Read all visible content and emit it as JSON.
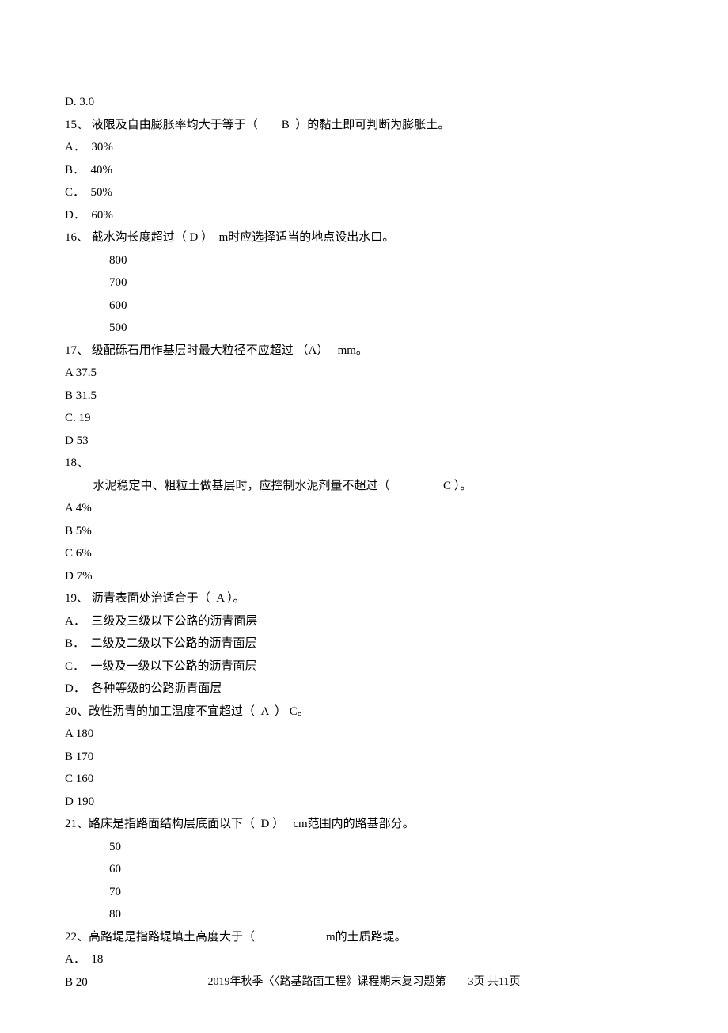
{
  "q14": {
    "optD": "D. 3.0"
  },
  "q15": {
    "stem_a": "15、 液限及自由膨胀率均大于等于（",
    "ans": "B",
    "stem_b": "）的黏土即可判断为膨胀土。",
    "A": "A．  30%",
    "B": "B．  40%",
    "C": "C．  50%",
    "D": "D．  60%"
  },
  "q16": {
    "stem_a": "16、 截水沟长度超过（ D ）  m时应选择适当的地点设出水口。",
    "A": "800",
    "B": "700",
    "C": "600",
    "D": "500"
  },
  "q17": {
    "stem": "17、 级配砾石用作基层时最大粒径不应超过 （A）   mm。",
    "A": "A 37.5",
    "B": "B 31.5",
    "C": "C. 19",
    "D": "D 53"
  },
  "q18": {
    "num": "18、",
    "stem_a": "水泥稳定中、粗粒土做基层时，应控制水泥剂量不超过（",
    "ans": "C",
    "stem_b": "）。",
    "A": "A 4%",
    "B": "B 5%",
    "C": "C 6%",
    "D": "D 7%"
  },
  "q19": {
    "stem": "19、 沥青表面处治适合于（  A ）。",
    "A": "A．  三级及三级以下公路的沥青面层",
    "B": "B．  二级及二级以下公路的沥青面层",
    "C": "C．  一级及一级以下公路的沥青面层",
    "D": "D．  各种等级的公路沥青面层"
  },
  "q20": {
    "stem": "20、改性沥青的加工温度不宜超过（  A  ） C。",
    "A": "A 180",
    "B": "B 170",
    "C": "C 160",
    "D": "D 190"
  },
  "q21": {
    "stem": "21、路床是指路面结构层底面以下（  D ）   cm范围内的路基部分。",
    "A": "50",
    "B": "60",
    "C": "70",
    "D": "80"
  },
  "q22": {
    "stem_a": "22、高路堤是指路堤填土高度大于（",
    "stem_b": "m的土质路堤。",
    "A": "A．  18",
    "B": "B 20"
  },
  "footer": {
    "text": "2019年秋季〈〈路基路面工程》课程期末复习题第",
    "page": "3页 共11页"
  }
}
